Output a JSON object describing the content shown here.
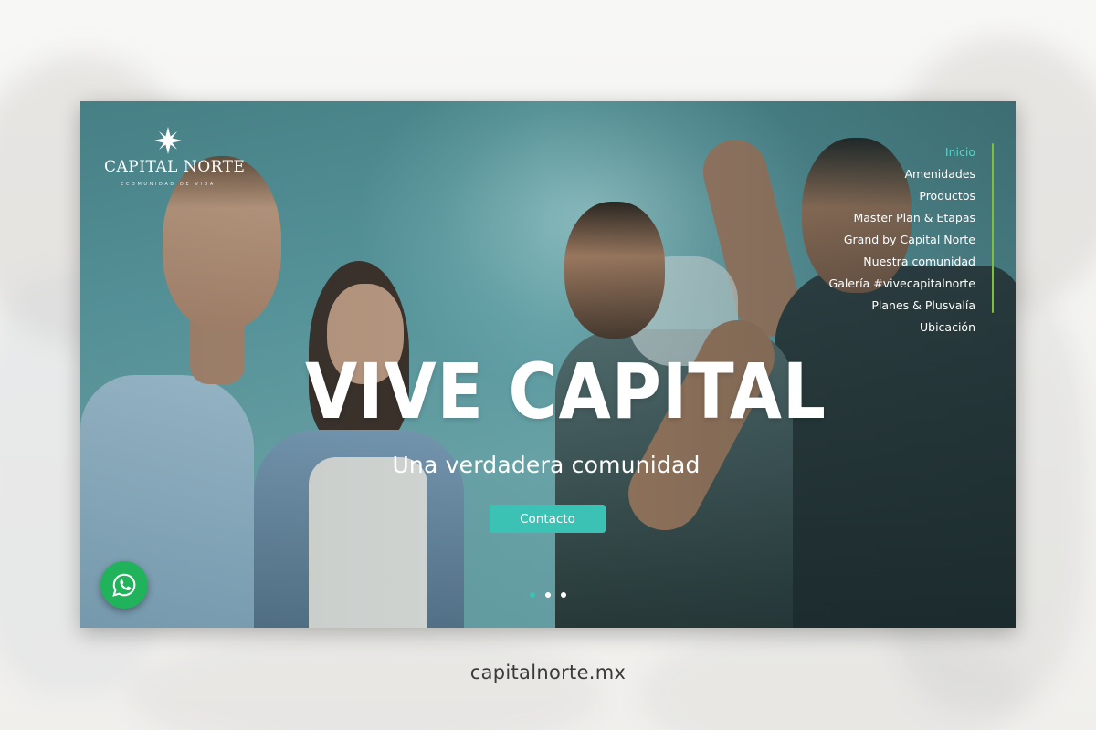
{
  "site": {
    "logo_name": "CAPITAL NORTE",
    "logo_tagline": "ECOMUNIDAD DE VIDA"
  },
  "nav": {
    "items": [
      {
        "label": "Inicio",
        "active": true
      },
      {
        "label": "Amenidades",
        "active": false
      },
      {
        "label": "Productos",
        "active": false
      },
      {
        "label": "Master Plan & Etapas",
        "active": false
      },
      {
        "label": "Grand by Capital Norte",
        "active": false
      },
      {
        "label": "Nuestra comunidad",
        "active": false
      },
      {
        "label": "Galería #vivecapitalnorte",
        "active": false
      },
      {
        "label": "Planes & Plusvalía",
        "active": false
      },
      {
        "label": "Ubicación",
        "active": false
      }
    ]
  },
  "hero": {
    "title": "VIVE CAPITAL",
    "subtitle": "Una verdadera comunidad",
    "cta_label": "Contacto"
  },
  "carousel": {
    "slides": 3,
    "active_index": 0
  },
  "footer": {
    "domain": "capitalnorte.mx"
  },
  "colors": {
    "accent": "#3cc2b4",
    "active_nav": "#5fd0c7",
    "nav_rail": "#7fbf3c",
    "whatsapp": "#21b35b"
  },
  "icons": {
    "logo": "compass-star-icon",
    "chat": "whatsapp-icon"
  }
}
